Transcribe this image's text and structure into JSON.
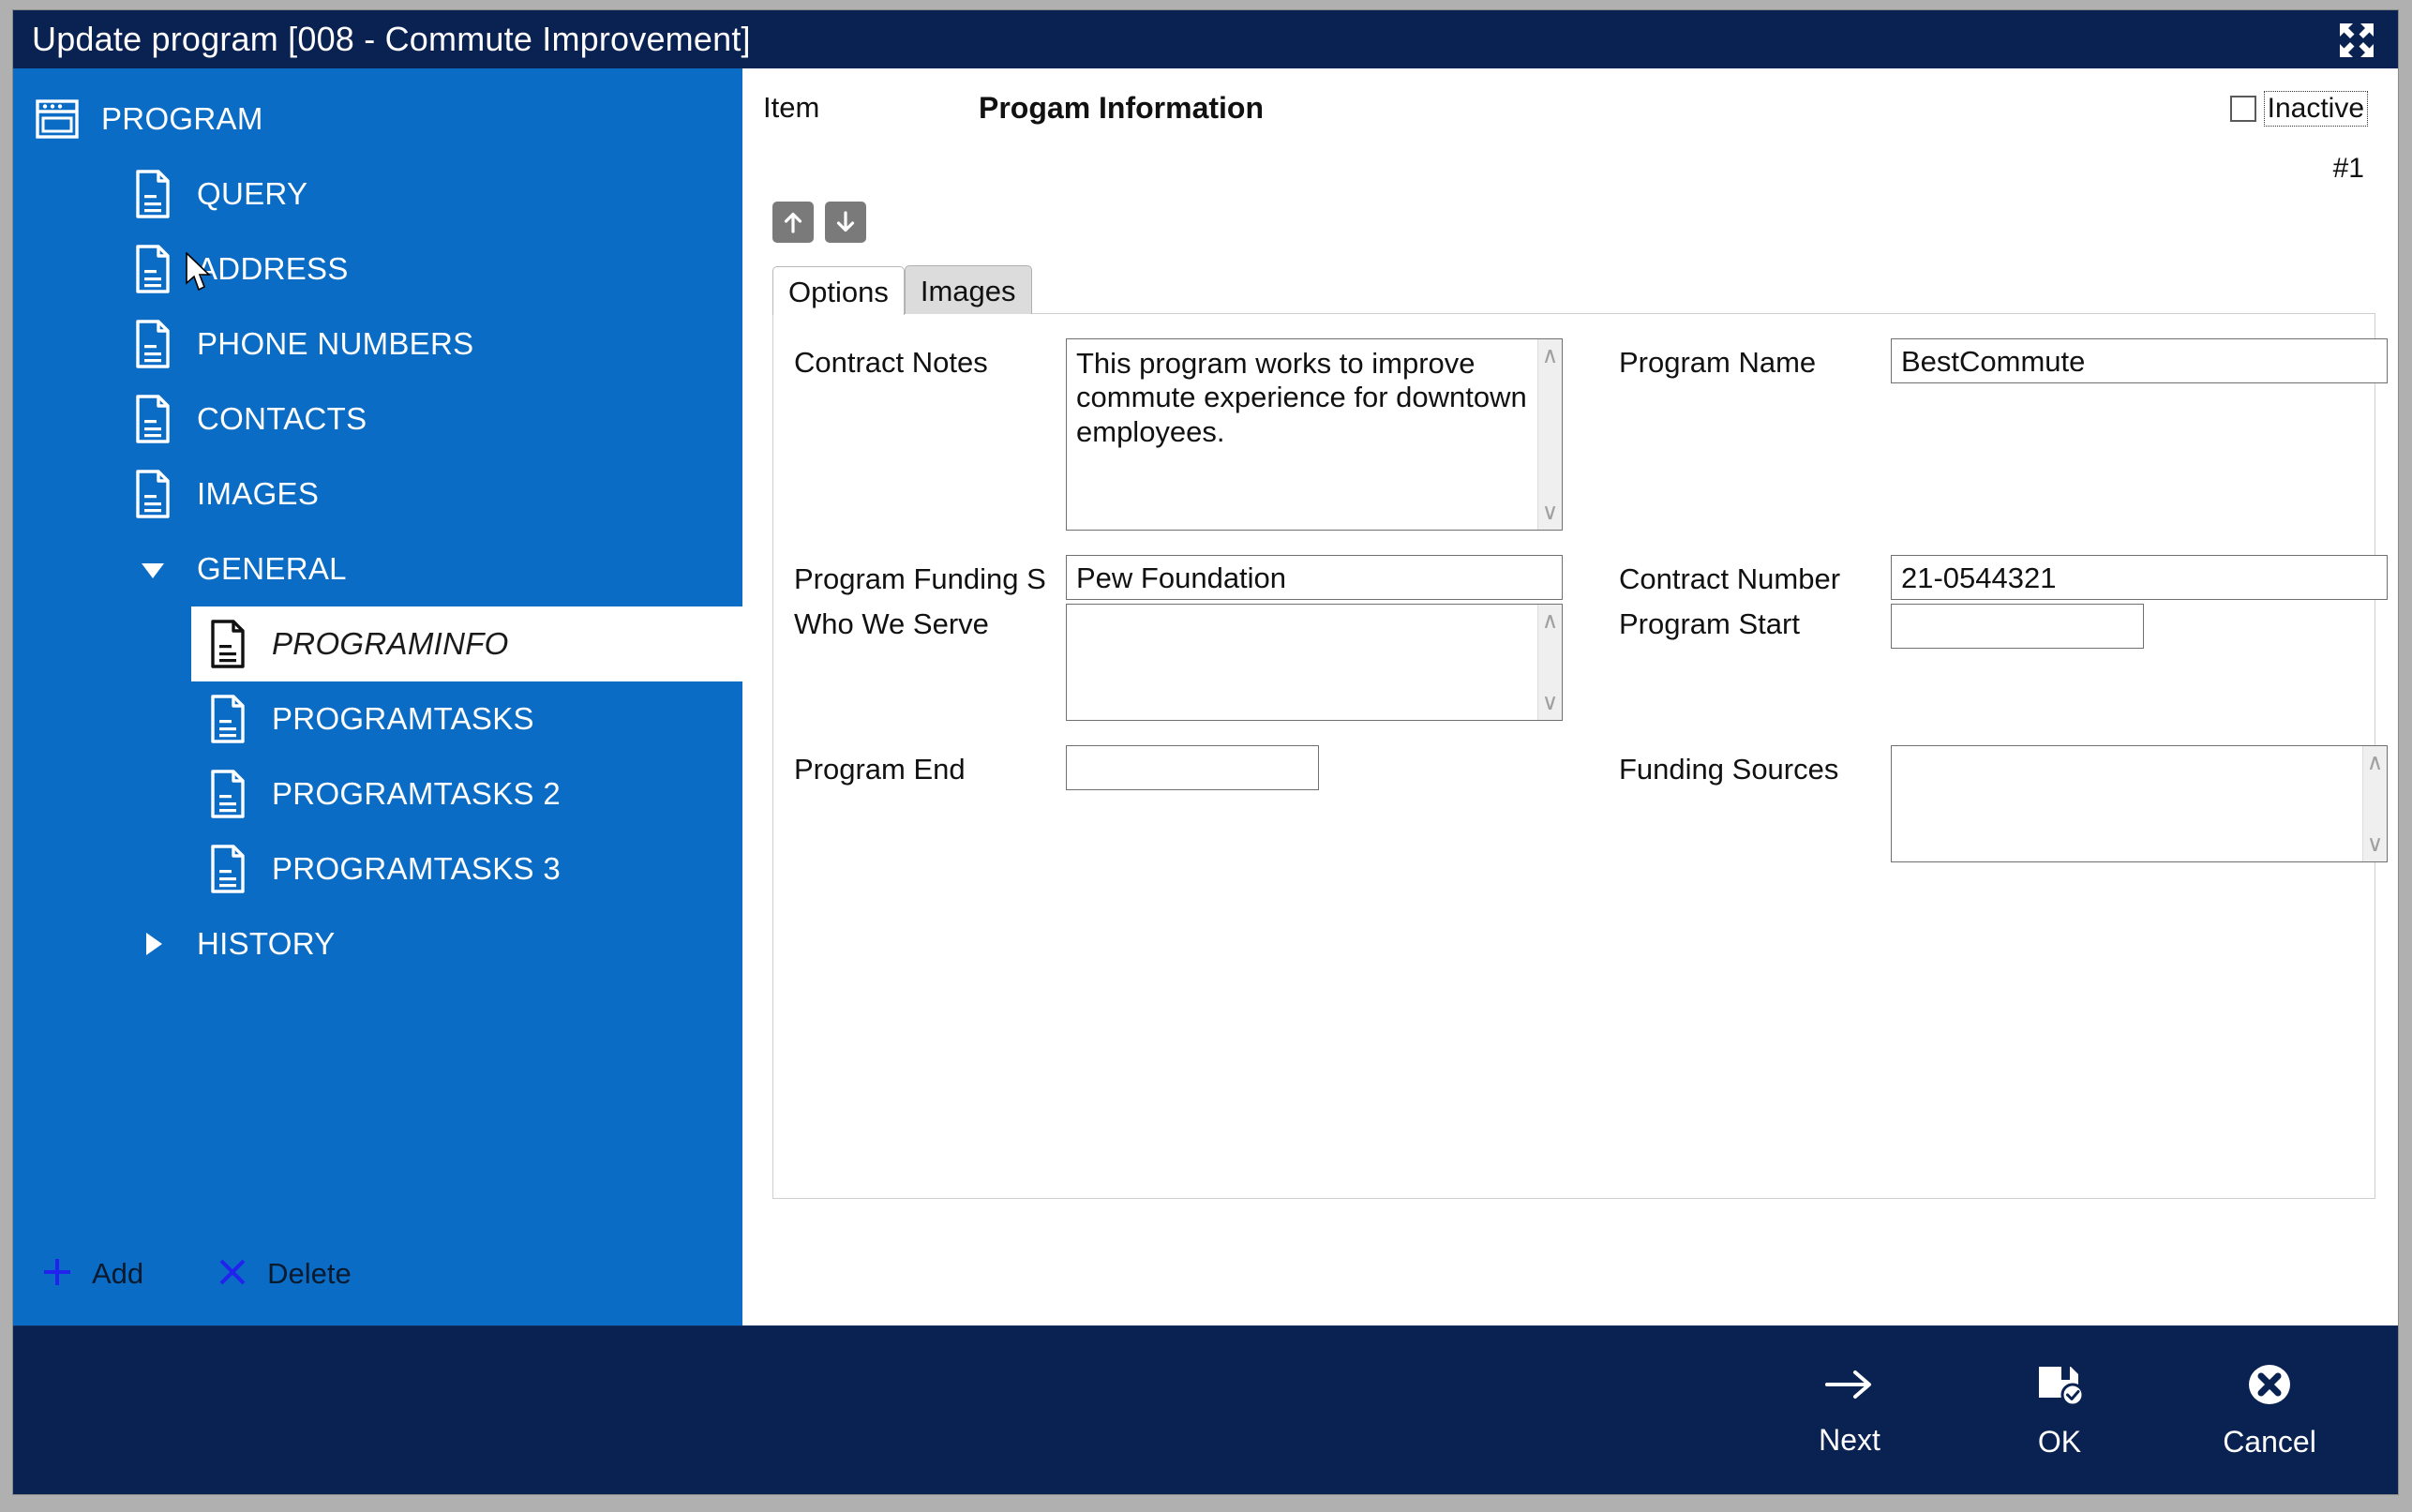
{
  "window": {
    "title": "Update program [008 - Commute Improvement]",
    "maximize_icon": "expand-arrows-icon",
    "titlebar_color": "#0a2252",
    "sidebar_color": "#0a6cc4"
  },
  "sidebar": {
    "items": [
      {
        "label": "PROGRAM",
        "icon": "window-icon",
        "level": 0,
        "selected": false,
        "expander": ""
      },
      {
        "label": "QUERY",
        "icon": "document-icon",
        "level": 1,
        "selected": false,
        "expander": ""
      },
      {
        "label": "ADDRESS",
        "icon": "document-icon",
        "level": 1,
        "selected": false,
        "expander": ""
      },
      {
        "label": "PHONE NUMBERS",
        "icon": "document-icon",
        "level": 1,
        "selected": false,
        "expander": ""
      },
      {
        "label": "CONTACTS",
        "icon": "document-icon",
        "level": 1,
        "selected": false,
        "expander": ""
      },
      {
        "label": "IMAGES",
        "icon": "document-icon",
        "level": 1,
        "selected": false,
        "expander": ""
      },
      {
        "label": "GENERAL",
        "icon": "",
        "level": 1,
        "selected": false,
        "expander": "expander-down-icon"
      },
      {
        "label": "PROGRAMINFO",
        "icon": "document-icon",
        "level": 2,
        "selected": true,
        "expander": ""
      },
      {
        "label": "PROGRAMTASKS",
        "icon": "document-icon",
        "level": 2,
        "selected": false,
        "expander": ""
      },
      {
        "label": "PROGRAMTASKS 2",
        "icon": "document-icon",
        "level": 2,
        "selected": false,
        "expander": ""
      },
      {
        "label": "PROGRAMTASKS 3",
        "icon": "document-icon",
        "level": 2,
        "selected": false,
        "expander": ""
      },
      {
        "label": "HISTORY",
        "icon": "",
        "level": 1,
        "selected": false,
        "expander": "expander-right-icon"
      }
    ],
    "footer": {
      "add_label": "Add",
      "add_icon": "plus-icon",
      "delete_label": "Delete",
      "delete_icon": "x-icon"
    }
  },
  "form": {
    "item_label": "Item",
    "item_heading": "Progam Information",
    "inactive_label": "Inactive",
    "inactive_checked": false,
    "record_counter": "#1",
    "move_up_icon": "arrow-up-icon",
    "move_down_icon": "arrow-down-icon",
    "tabs": [
      {
        "label": "Options",
        "active": true
      },
      {
        "label": "Images",
        "active": false
      }
    ],
    "fields": {
      "contract_notes": {
        "label": "Contract Notes",
        "value": "This program works to improve commute experience for downtown employees.",
        "placeholder": ""
      },
      "program_name": {
        "label": "Program Name",
        "value": "BestCommute",
        "placeholder": ""
      },
      "program_funding_source": {
        "label": "Program Funding S",
        "value": "Pew Foundation",
        "placeholder": ""
      },
      "contract_number": {
        "label": "Contract Number",
        "value": "21-0544321",
        "placeholder": ""
      },
      "who_we_serve": {
        "label": "Who We Serve",
        "value": "",
        "placeholder": ""
      },
      "program_start": {
        "label": "Program Start",
        "value": "",
        "placeholder": ""
      },
      "program_end": {
        "label": "Program End",
        "value": "",
        "placeholder": ""
      },
      "funding_sources": {
        "label": "Funding Sources",
        "value": "",
        "placeholder": ""
      }
    }
  },
  "bottombar": {
    "buttons": [
      {
        "label": "Next",
        "icon": "arrow-right-icon"
      },
      {
        "label": "OK",
        "icon": "save-check-icon"
      },
      {
        "label": "Cancel",
        "icon": "circle-x-icon"
      }
    ]
  }
}
